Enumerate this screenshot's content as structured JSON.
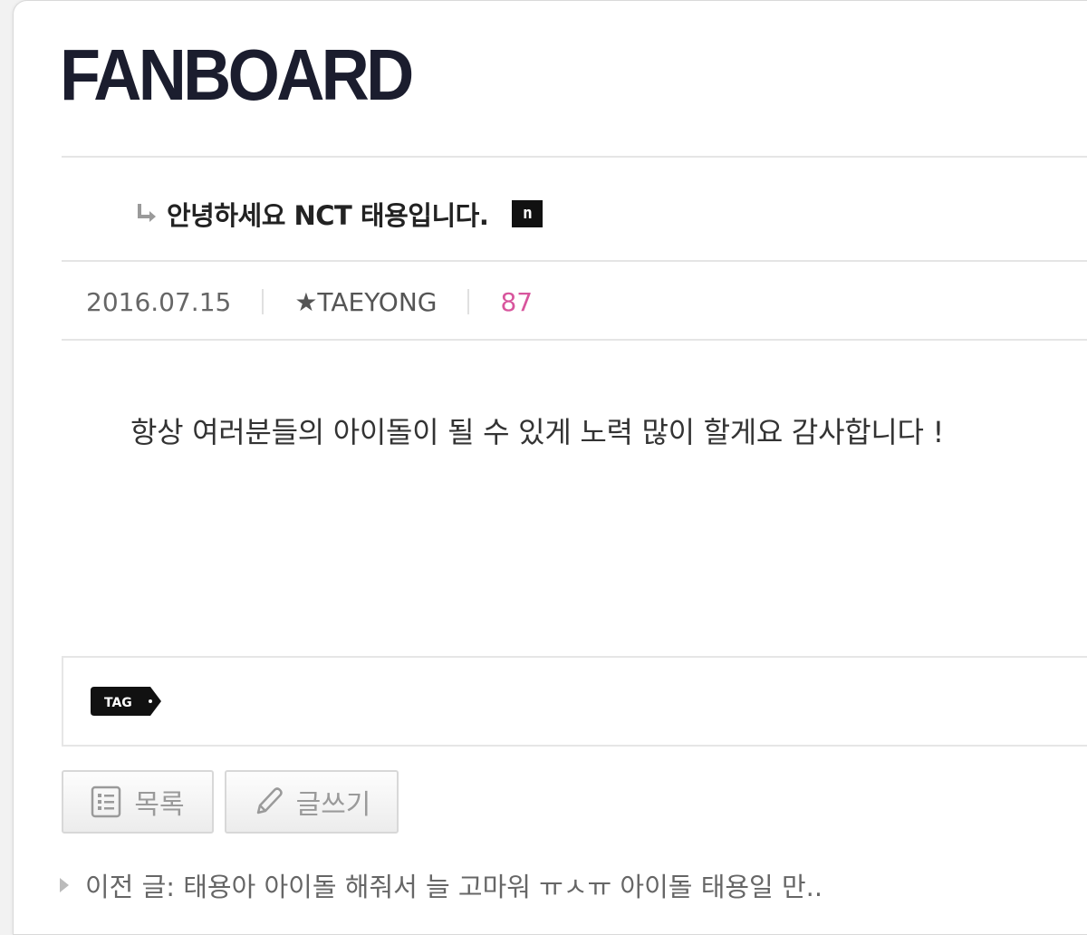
{
  "header": {
    "logo_text": "FANBOARD"
  },
  "post": {
    "title": "안녕하세요 NCT 태용입니다.",
    "new_badge": "n",
    "date": "2016.07.15",
    "author": "★TAEYONG",
    "views": "87",
    "body": "항상 여러분들의 아이돌이 될 수 있게 노력 많이 할게요 감사합니다 !"
  },
  "tags": {
    "label": "TAG"
  },
  "actions": {
    "list_label": "목록",
    "write_label": "글쓰기"
  },
  "navigation": {
    "prev_label": "이전 글: 태용아 아이돌 해줘서 늘 고마워 ㅠㅅㅠ 아이돌 태용일 만.."
  },
  "colors": {
    "views_accent": "#d8559d",
    "logo": "#1b1d2e"
  }
}
